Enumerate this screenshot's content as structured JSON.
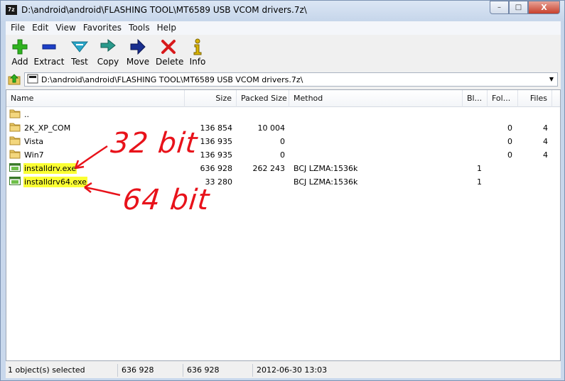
{
  "window": {
    "title": "D:\\android\\android\\FLASHING TOOL\\MT6589 USB VCOM drivers.7z\\",
    "app_icon": "7z",
    "controls": {
      "minimize": "–",
      "maximize": "□",
      "close": "X"
    }
  },
  "menu": [
    "File",
    "Edit",
    "View",
    "Favorites",
    "Tools",
    "Help"
  ],
  "toolbar": [
    {
      "label": "Add",
      "icon": "plus-icon",
      "color": "#2fb31f"
    },
    {
      "label": "Extract",
      "icon": "minus-icon",
      "color": "#1d3fc7"
    },
    {
      "label": "Test",
      "icon": "check-down-icon",
      "color": "#2aa6c8"
    },
    {
      "label": "Copy",
      "icon": "double-arrow-icon",
      "color": "#2a9a8c"
    },
    {
      "label": "Move",
      "icon": "arrow-right-icon",
      "color": "#1a2f8f"
    },
    {
      "label": "Delete",
      "icon": "x-icon",
      "color": "#d8191b"
    },
    {
      "label": "Info",
      "icon": "info-icon",
      "color": "#d9b300"
    }
  ],
  "address": {
    "path": "D:\\android\\android\\FLASHING TOOL\\MT6589 USB VCOM drivers.7z\\"
  },
  "columns": [
    "Name",
    "Size",
    "Packed Size",
    "Method",
    "Bl...",
    "Fol...",
    "Files"
  ],
  "rows": [
    {
      "name": "..",
      "type": "folder",
      "size": "",
      "packed": "",
      "method": "",
      "blocks": "",
      "folders": "",
      "files": ""
    },
    {
      "name": "2K_XP_COM",
      "type": "folder",
      "size": "136 854",
      "packed": "10 004",
      "method": "",
      "blocks": "",
      "folders": "0",
      "files": "4"
    },
    {
      "name": "Vista",
      "type": "folder",
      "size": "136 935",
      "packed": "0",
      "method": "",
      "blocks": "",
      "folders": "0",
      "files": "4"
    },
    {
      "name": "Win7",
      "type": "folder",
      "size": "136 935",
      "packed": "0",
      "method": "",
      "blocks": "",
      "folders": "0",
      "files": "4"
    },
    {
      "name": "installdrv.exe",
      "type": "exe",
      "highlight": true,
      "size": "636 928",
      "packed": "262 243",
      "method": "BCJ LZMA:1536k",
      "blocks": "1",
      "folders": "",
      "files": ""
    },
    {
      "name": "installdrv64.exe",
      "type": "exe",
      "highlight": true,
      "size": "33 280",
      "packed": "",
      "method": "BCJ LZMA:1536k",
      "blocks": "1",
      "folders": "",
      "files": ""
    }
  ],
  "annotations": {
    "label_32": "32 bit",
    "label_64": "64 bit",
    "color": "#e8121a"
  },
  "status": {
    "selected": "1 object(s) selected",
    "size": "636 928",
    "packed": "636 928",
    "modified": "2012-06-30 13:03"
  }
}
